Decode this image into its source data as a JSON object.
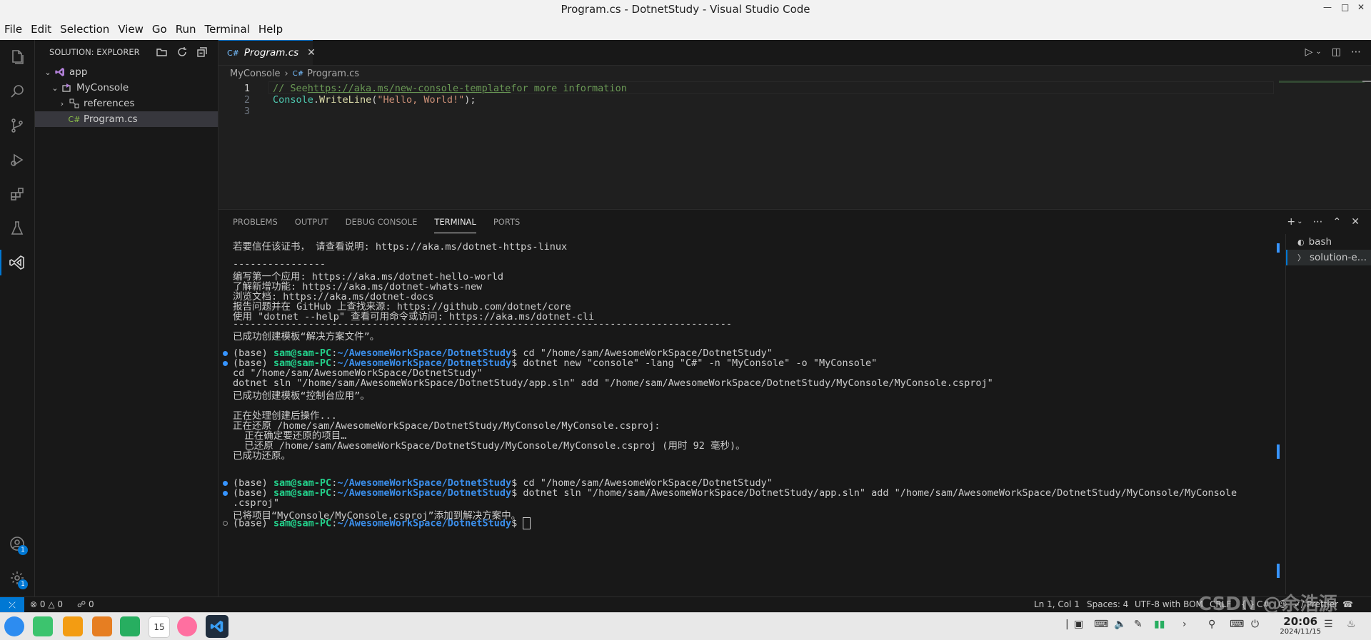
{
  "window": {
    "title": "Program.cs - DotnetStudy - Visual Studio Code"
  },
  "menu": [
    "File",
    "Edit",
    "Selection",
    "View",
    "Go",
    "Run",
    "Terminal",
    "Help"
  ],
  "activity_bar": {
    "accounts_badge": "1",
    "manage_badge": "1"
  },
  "sidebar": {
    "title": "SOLUTION: EXPLORER",
    "tree": [
      {
        "label": "app"
      },
      {
        "label": "MyConsole"
      },
      {
        "label": "references"
      },
      {
        "label": "Program.cs",
        "icon_text": "C#"
      }
    ]
  },
  "editor": {
    "tab": {
      "label": "Program.cs",
      "icon_text": "C#"
    },
    "breadcrumb": [
      "MyConsole",
      "Program.cs"
    ],
    "lines": [
      {
        "num": "1",
        "parts": [
          [
            "// See ",
            "comment"
          ],
          [
            "https://aka.ms/new-console-template",
            "link"
          ],
          [
            " for more information",
            "comment"
          ]
        ]
      },
      {
        "num": "2",
        "parts": [
          [
            "Console",
            "cls"
          ],
          [
            ".",
            "def"
          ],
          [
            "WriteLine",
            "fn"
          ],
          [
            "(",
            "def"
          ],
          [
            "\"Hello, World!\"",
            "str"
          ],
          [
            ");",
            "def"
          ]
        ]
      },
      {
        "num": "3",
        "parts": []
      }
    ]
  },
  "panel": {
    "tabs": [
      "PROBLEMS",
      "OUTPUT",
      "DEBUG CONSOLE",
      "TERMINAL",
      "PORTS"
    ],
    "active_tab": "TERMINAL",
    "terminal_lines": [
      {
        "text": "若要信任该证书， 请查看说明: https://aka.ms/dotnet-https-linux"
      },
      {
        "text": ""
      },
      {
        "text": "----------------"
      },
      {
        "text": "编写第一个应用: https://aka.ms/dotnet-hello-world"
      },
      {
        "text": "了解新增功能: https://aka.ms/dotnet-whats-new"
      },
      {
        "text": "浏览文档: https://aka.ms/dotnet-docs"
      },
      {
        "text": "报告问题并在 GitHub 上查找来源: https://github.com/dotnet/core"
      },
      {
        "text": "使用 \"dotnet --help\" 查看可用命令或访问: https://aka.ms/dotnet-cli"
      },
      {
        "text": "--------------------------------------------------------------------------------------"
      },
      {
        "text": "已成功创建模板“解决方案文件”。"
      },
      {
        "text": ""
      },
      {
        "prompt": true,
        "dot": "blue",
        "pre": "(base) ",
        "user": "sam@sam-PC",
        "path": "~/AwesomeWorkSpace/DotnetStudy",
        "cmd": "$ cd \"/home/sam/AwesomeWorkSpace/DotnetStudy\""
      },
      {
        "prompt": true,
        "dot": "blue",
        "pre": "(base) ",
        "user": "sam@sam-PC",
        "path": "~/AwesomeWorkSpace/DotnetStudy",
        "cmd": "$ dotnet new \"console\" -lang \"C#\" -n \"MyConsole\" -o \"MyConsole\""
      },
      {
        "text": "cd \"/home/sam/AwesomeWorkSpace/DotnetStudy\""
      },
      {
        "text": "dotnet sln \"/home/sam/AwesomeWorkSpace/DotnetStudy/app.sln\" add \"/home/sam/AwesomeWorkSpace/DotnetStudy/MyConsole/MyConsole.csproj\""
      },
      {
        "text": "已成功创建模板“控制台应用”。"
      },
      {
        "text": ""
      },
      {
        "text": "正在处理创建后操作..."
      },
      {
        "text": "正在还原 /home/sam/AwesomeWorkSpace/DotnetStudy/MyConsole/MyConsole.csproj:"
      },
      {
        "text": "  正在确定要还原的项目…"
      },
      {
        "text": "  已还原 /home/sam/AwesomeWorkSpace/DotnetStudy/MyConsole/MyConsole.csproj (用时 92 毫秒)。"
      },
      {
        "text": "已成功还原。"
      },
      {
        "text": ""
      },
      {
        "text": ""
      },
      {
        "prompt": true,
        "dot": "blue",
        "pre": "(base) ",
        "user": "sam@sam-PC",
        "path": "~/AwesomeWorkSpace/DotnetStudy",
        "cmd": "$ cd \"/home/sam/AwesomeWorkSpace/DotnetStudy\""
      },
      {
        "prompt": true,
        "dot": "blue",
        "pre": "(base) ",
        "user": "sam@sam-PC",
        "path": "~/AwesomeWorkSpace/DotnetStudy",
        "cmd": "$ dotnet sln \"/home/sam/AwesomeWorkSpace/DotnetStudy/app.sln\" add \"/home/sam/AwesomeWorkSpace/DotnetStudy/MyConsole/MyConsole"
      },
      {
        "text": ".csproj\""
      },
      {
        "text": "已将项目“MyConsole/MyConsole.csproj”添加到解决方案中。"
      },
      {
        "prompt": true,
        "dot": "empty",
        "pre": "(base) ",
        "user": "sam@sam-PC",
        "path": "~/AwesomeWorkSpace/DotnetStudy",
        "cmd": "$ ",
        "cursor": true
      }
    ],
    "terminal_list": [
      "bash",
      "solution-e…"
    ]
  },
  "statusbar": {
    "errors": "0",
    "warnings": "0",
    "ports": "0",
    "position": "Ln 1, Col 1",
    "spaces": "Spaces: 4",
    "encoding": "UTF-8 with BOM",
    "eol": "CRLF",
    "language": "C#",
    "formatter": "Prettier"
  },
  "taskbar": {
    "time": "20:06",
    "date": "2024/11/15",
    "calendar_day": "15"
  },
  "watermark": "CSDN @余浩源",
  "colors": {
    "accent": "#0078d4",
    "prompt_user": "#23d18b",
    "prompt_path": "#3b8eea"
  }
}
